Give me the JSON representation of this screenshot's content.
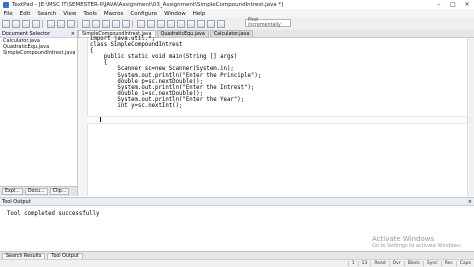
{
  "window": {
    "title": "TextPad - [E:\\MSC IT\\SEMESTER-II\\JAVA\\Assignment\\03_Assignment\\SimpleCompoundIntrest.java *]",
    "controls": [
      "–",
      "□",
      "✕"
    ]
  },
  "menu": [
    "File",
    "Edit",
    "Search",
    "View",
    "Tools",
    "Macros",
    "Configure",
    "Window",
    "Help"
  ],
  "toolbar": {
    "find_placeholder": "Find incrementally"
  },
  "document_selector": {
    "title": "Document Selector",
    "close": "×",
    "files": [
      "Calculator.java",
      "QuadraticEqu.java",
      "SimpleCompoundIntrest.java"
    ],
    "tabs": [
      "Expl...",
      "Docu...",
      "Clip..."
    ]
  },
  "editor_tabs": [
    "SimpleCompoundIntrest.java",
    "QuadraticEqu.java",
    "Calculator.java"
  ],
  "code_lines": [
    "import java.util.*;",
    "class SimpleCompoundIntrest",
    "{",
    "    public static void main(String [] args)",
    "    {",
    "        Scanner sc=new Scanner(System.in);",
    "        System.out.println(\"Enter the Principle\");",
    "        double p=sc.nextDouble();",
    "        System.out.println(\"Enter the Intrest\");",
    "        double i=sc.nextDouble();",
    "        System.out.println(\"Enter the Year\");",
    "        int y=sc.nextInt();",
    "",
    "        "
  ],
  "tool_output": {
    "title": "Tool Output",
    "text": "Tool completed successfully"
  },
  "bottom_tabs": [
    "Search Results",
    "Tool Output"
  ],
  "watermark": {
    "title": "Activate Windows",
    "subtitle": "Go to Settings to activate Windows."
  },
  "status": [
    "1",
    "13",
    "Read",
    "Ovr",
    "Block",
    "Sync",
    "Rec",
    "Caps"
  ]
}
